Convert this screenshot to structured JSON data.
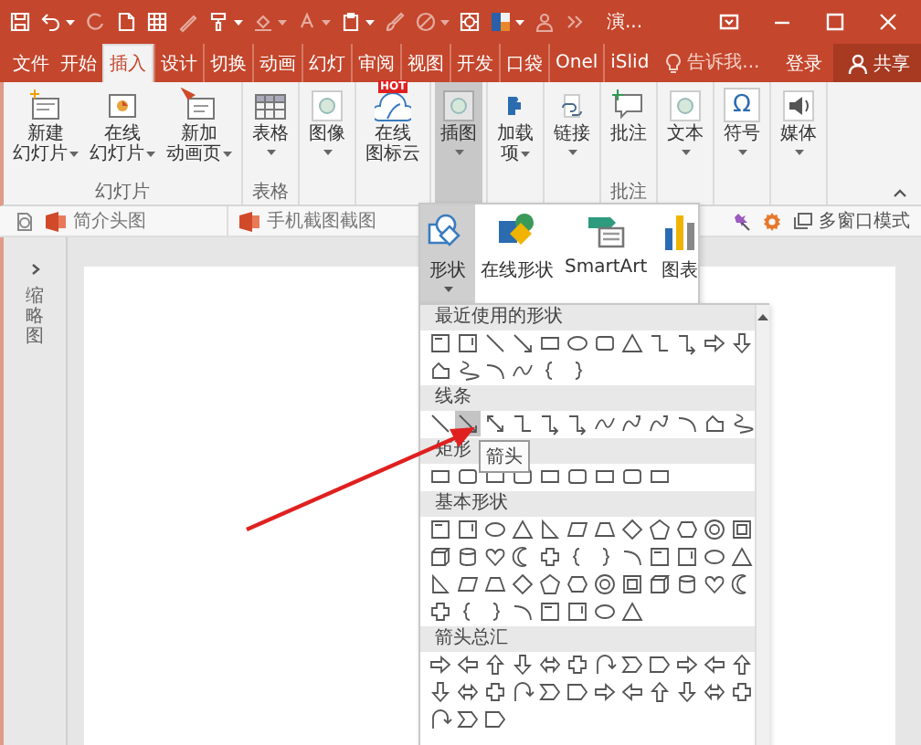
{
  "title_bar": {
    "document_title": "演..."
  },
  "tabs": [
    {
      "label": "文件",
      "selected": false
    },
    {
      "label": "开始",
      "selected": false
    },
    {
      "label": "插入",
      "selected": true
    },
    {
      "label": "设计",
      "selected": false
    },
    {
      "label": "切换",
      "selected": false
    },
    {
      "label": "动画",
      "selected": false
    },
    {
      "label": "幻灯",
      "selected": false
    },
    {
      "label": "审阅",
      "selected": false
    },
    {
      "label": "视图",
      "selected": false
    },
    {
      "label": "开发",
      "selected": false
    },
    {
      "label": "口袋",
      "selected": false
    },
    {
      "label": "Onel",
      "selected": false
    },
    {
      "label": "iSlid",
      "selected": false
    }
  ],
  "search": {
    "placeholder": "告诉我..."
  },
  "sign_in": "登录",
  "share": "共享",
  "ribbon": {
    "groups": [
      {
        "label": "幻灯片",
        "buttons": [
          {
            "lines": [
              "新建",
              "幻灯片"
            ],
            "dropdown": true,
            "pressed": false
          },
          {
            "lines": [
              "在线",
              "幻灯片"
            ],
            "dropdown": true,
            "pressed": false
          },
          {
            "lines": [
              "新加",
              "动画页"
            ],
            "dropdown": true,
            "pressed": false
          }
        ]
      },
      {
        "label": "表格",
        "buttons": [
          {
            "lines": [
              "表格"
            ],
            "dropdown": true,
            "pressed": false
          }
        ]
      },
      {
        "buttons": [
          {
            "lines": [
              "图像"
            ],
            "dropdown": true,
            "pressed": false
          }
        ]
      },
      {
        "buttons": [
          {
            "lines": [
              "在线",
              "图标云"
            ],
            "dropdown": false,
            "pressed": false,
            "badge": "HOT"
          }
        ]
      },
      {
        "buttons": [
          {
            "lines": [
              "插图"
            ],
            "dropdown": true,
            "pressed": true
          }
        ]
      },
      {
        "buttons": [
          {
            "lines": [
              "加载",
              "项"
            ],
            "dropdown": true,
            "pressed": false
          }
        ]
      },
      {
        "buttons": [
          {
            "lines": [
              "链接"
            ],
            "dropdown": true,
            "pressed": false
          }
        ]
      },
      {
        "label": "批注",
        "buttons": [
          {
            "lines": [
              "批注"
            ],
            "dropdown": false,
            "pressed": false
          }
        ]
      },
      {
        "buttons": [
          {
            "lines": [
              "文本"
            ],
            "dropdown": true,
            "pressed": false
          }
        ]
      },
      {
        "buttons": [
          {
            "lines": [
              "符号"
            ],
            "dropdown": true,
            "pressed": false,
            "glyph": "Ω"
          }
        ]
      },
      {
        "buttons": [
          {
            "lines": [
              "媒体"
            ],
            "dropdown": true,
            "pressed": false
          }
        ]
      }
    ]
  },
  "quick_bar": {
    "documents": [
      {
        "title": "简介头图"
      },
      {
        "title": "手机截图截图"
      }
    ],
    "window_mode": "多窗口模式"
  },
  "side_panel": {
    "title": "缩略图"
  },
  "illustrations_menu": {
    "items": [
      {
        "label": "形状",
        "selected": true,
        "dropdown": true
      },
      {
        "label": "在线形状",
        "selected": false,
        "dropdown": false
      },
      {
        "label": "SmartArt",
        "selected": false,
        "dropdown": false
      },
      {
        "label": "图表",
        "selected": false,
        "dropdown": false
      }
    ]
  },
  "shapes_gallery": {
    "sections": [
      {
        "title": "最近使用的形状",
        "shapes": [
          {
            "selected": false
          },
          {
            "selected": false
          },
          {
            "selected": false
          },
          {
            "selected": false
          },
          {
            "selected": false
          },
          {
            "selected": false
          },
          {
            "selected": false
          },
          {
            "selected": false
          },
          {
            "selected": false
          },
          {
            "selected": false
          },
          {
            "selected": false
          },
          {
            "selected": false
          },
          {
            "selected": false
          },
          {
            "selected": false
          },
          {
            "selected": false
          },
          {
            "selected": false
          },
          {
            "selected": false
          },
          {
            "selected": false
          }
        ]
      },
      {
        "title": "线条",
        "shapes": [
          {
            "selected": false
          },
          {
            "selected": true
          },
          {
            "selected": false
          },
          {
            "selected": false
          },
          {
            "selected": false
          },
          {
            "selected": false
          },
          {
            "selected": false
          },
          {
            "selected": false
          },
          {
            "selected": false
          },
          {
            "selected": false
          },
          {
            "selected": false
          },
          {
            "selected": false
          }
        ]
      },
      {
        "title": "矩形",
        "shapes": [
          {
            "selected": false
          },
          {
            "selected": false
          },
          {
            "selected": false
          },
          {
            "selected": false
          },
          {
            "selected": false
          },
          {
            "selected": false
          },
          {
            "selected": false
          },
          {
            "selected": false
          },
          {
            "selected": false
          }
        ]
      },
      {
        "title": "基本形状",
        "shapes": [
          {
            "selected": false
          },
          {
            "selected": false
          },
          {
            "selected": false
          },
          {
            "selected": false
          },
          {
            "selected": false
          },
          {
            "selected": false
          },
          {
            "selected": false
          },
          {
            "selected": false
          },
          {
            "selected": false
          },
          {
            "selected": false
          },
          {
            "selected": false
          },
          {
            "selected": false
          },
          {
            "selected": false
          },
          {
            "selected": false
          },
          {
            "selected": false
          },
          {
            "selected": false
          },
          {
            "selected": false
          },
          {
            "selected": false
          },
          {
            "selected": false
          },
          {
            "selected": false
          },
          {
            "selected": false
          },
          {
            "selected": false
          },
          {
            "selected": false
          },
          {
            "selected": false
          },
          {
            "selected": false
          },
          {
            "selected": false
          },
          {
            "selected": false
          },
          {
            "selected": false
          },
          {
            "selected": false
          },
          {
            "selected": false
          },
          {
            "selected": false
          },
          {
            "selected": false
          },
          {
            "selected": false
          },
          {
            "selected": false
          },
          {
            "selected": false
          },
          {
            "selected": false
          },
          {
            "selected": false
          },
          {
            "selected": false
          },
          {
            "selected": false
          },
          {
            "selected": false
          },
          {
            "selected": false
          },
          {
            "selected": false
          },
          {
            "selected": false
          },
          {
            "selected": false
          }
        ]
      },
      {
        "title": "箭头总汇",
        "shapes": [
          {
            "selected": false
          },
          {
            "selected": false
          },
          {
            "selected": false
          },
          {
            "selected": false
          },
          {
            "selected": false
          },
          {
            "selected": false
          },
          {
            "selected": false
          },
          {
            "selected": false
          },
          {
            "selected": false
          },
          {
            "selected": false
          },
          {
            "selected": false
          },
          {
            "selected": false
          },
          {
            "selected": false
          },
          {
            "selected": false
          },
          {
            "selected": false
          },
          {
            "selected": false
          },
          {
            "selected": false
          },
          {
            "selected": false
          },
          {
            "selected": false
          },
          {
            "selected": false
          },
          {
            "selected": false
          },
          {
            "selected": false
          },
          {
            "selected": false
          },
          {
            "selected": false
          },
          {
            "selected": false
          },
          {
            "selected": false
          },
          {
            "selected": false
          }
        ]
      }
    ]
  },
  "tooltip": {
    "text": "箭头"
  }
}
